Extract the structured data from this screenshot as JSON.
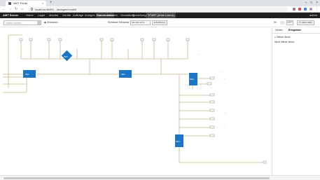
{
  "browser": {
    "tab_title": "AMT Portal",
    "url": "localhost:8080/…/anlagen/modell",
    "nav_back": "←",
    "nav_forward": "→",
    "nav_reload": "↻",
    "nav_home": "⌂",
    "new_tab": "+",
    "tab_close": "×",
    "win_min": "–",
    "win_max": "□",
    "win_close": "×"
  },
  "appnav": {
    "brand": "AMT Server",
    "items": [
      {
        "label": "Home"
      },
      {
        "label": "Lager"
      },
      {
        "label": "Monitor"
      },
      {
        "label": "Geräte"
      },
      {
        "label": "Aufträge"
      },
      {
        "label": "Anlagen"
      },
      {
        "label": "Stammdaten"
      },
      {
        "label": "Admin"
      },
      {
        "label": "Verwaltung"
      },
      {
        "label": "Einstellungen"
      }
    ],
    "start_button": "START (ohne Lizenz)",
    "user": "admin"
  },
  "toolbar": {
    "search_placeholder": "Objekt suchen…",
    "search_btn_icon": "▾",
    "anchor_label": "◆ Zentrieren",
    "view_label": "Sichtbare Elemente",
    "view_select": "Alle Elemente",
    "view_btn": "▸ Zentrieren",
    "zoom_label": "90",
    "toggle_state": "OFF",
    "refresh_btn": "⟳ Laden aktiv"
  },
  "panel": {
    "tabs": [
      "Details",
      "Ereignisse"
    ],
    "active_tab": 1,
    "items": [
      {
        "label": "Offene Items"
      },
      {
        "label": "Nicht offene Items"
      }
    ]
  },
  "diagram": {
    "boxes": [
      {
        "label": "SE1"
      },
      {
        "label": "SE2"
      },
      {
        "label": "SE3"
      },
      {
        "label": "SE4"
      },
      {
        "label": "SE5"
      }
    ]
  },
  "colors": {
    "accent": "#1b74c4",
    "line": "#c9b88a",
    "nav_bg": "#1f1f1f"
  }
}
